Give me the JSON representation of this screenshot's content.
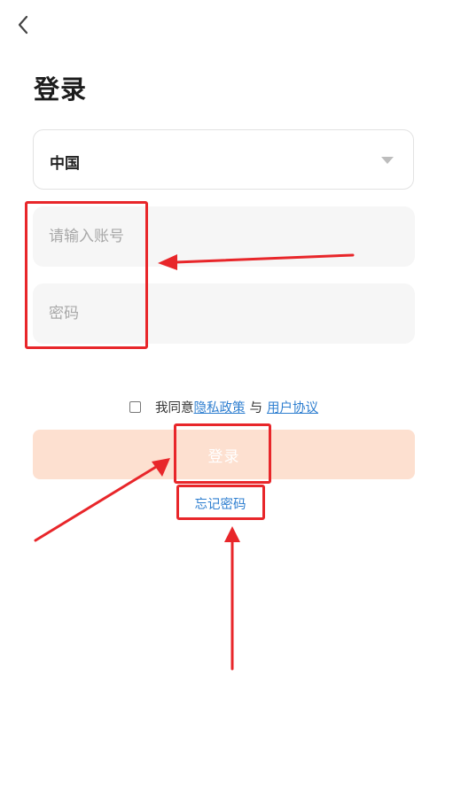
{
  "header": {
    "title": "登录"
  },
  "region": {
    "value": "中国"
  },
  "form": {
    "account_placeholder": "请输入账号",
    "password_placeholder": "密码"
  },
  "agreement": {
    "prefix": "我同意",
    "privacy_link": "隐私政策",
    "separator": "与",
    "terms_link": "用户协议",
    "checked": false
  },
  "actions": {
    "login_label": "登录",
    "forgot_label": "忘记密码"
  },
  "colors": {
    "login_button_bg": "#fde0d0",
    "link": "#2f7fd0",
    "annotation": "#e8262a"
  }
}
